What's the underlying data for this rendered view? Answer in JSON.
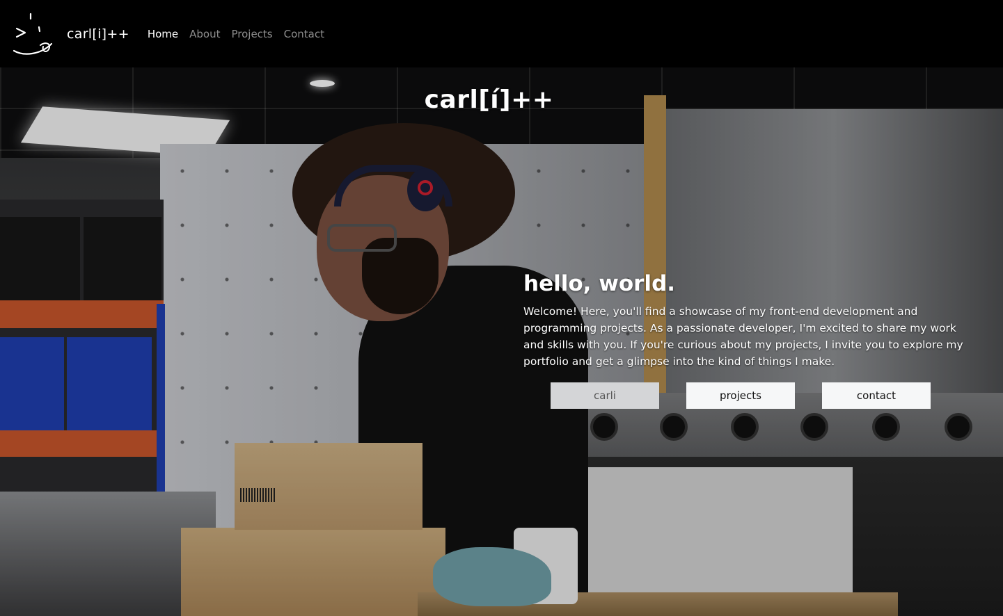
{
  "navbar": {
    "brand": "carl[i]++",
    "logo_icon": "smiley-logo-icon",
    "links": [
      {
        "label": "Home",
        "active": true
      },
      {
        "label": "About",
        "active": false
      },
      {
        "label": "Projects",
        "active": false
      },
      {
        "label": "Contact",
        "active": false
      }
    ]
  },
  "hero": {
    "title": "carl[í]++",
    "heading": "hello, world.",
    "text": "Welcome! Here, you'll find a showcase of my front-end development and programming projects. As a passionate developer, I'm excited to share my work and skills with you. If you're curious about my projects, I invite you to explore my portfolio and get a glimpse into the kind of things I make.",
    "buttons": [
      {
        "label": "carli",
        "style": "muted"
      },
      {
        "label": "projects",
        "style": "light"
      },
      {
        "label": "contact",
        "style": "light"
      }
    ]
  },
  "colors": {
    "navbar_bg": "#000000",
    "text": "#ffffff",
    "button_bg": "#f6f7f8",
    "button_muted_bg": "#d4d5d7"
  }
}
